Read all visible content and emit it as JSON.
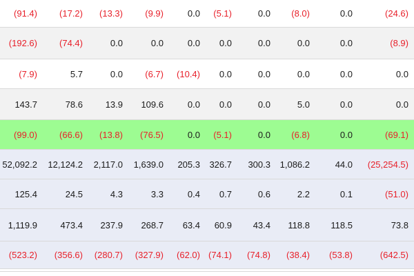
{
  "table": {
    "rows": [
      {
        "bg": "white",
        "cells": [
          {
            "text": "(91.4)",
            "neg": true
          },
          {
            "text": "(17.2)",
            "neg": true
          },
          {
            "text": "(13.3)",
            "neg": true
          },
          {
            "text": "(9.9)",
            "neg": true
          },
          {
            "text": "0.0",
            "neg": false
          },
          {
            "text": "(5.1)",
            "neg": true
          },
          {
            "text": "0.0",
            "neg": false
          },
          {
            "text": "(8.0)",
            "neg": true
          },
          {
            "text": "0.0",
            "neg": false
          },
          {
            "text": "(24.6)",
            "neg": true
          }
        ]
      },
      {
        "bg": "gray",
        "cells": [
          {
            "text": "(192.6)",
            "neg": true
          },
          {
            "text": "(74.4)",
            "neg": true
          },
          {
            "text": "0.0",
            "neg": false
          },
          {
            "text": "0.0",
            "neg": false
          },
          {
            "text": "0.0",
            "neg": false
          },
          {
            "text": "0.0",
            "neg": false
          },
          {
            "text": "0.0",
            "neg": false
          },
          {
            "text": "0.0",
            "neg": false
          },
          {
            "text": "0.0",
            "neg": false
          },
          {
            "text": "(8.9)",
            "neg": true
          }
        ]
      },
      {
        "bg": "white",
        "cells": [
          {
            "text": "(7.9)",
            "neg": true
          },
          {
            "text": "5.7",
            "neg": false
          },
          {
            "text": "0.0",
            "neg": false
          },
          {
            "text": "(6.7)",
            "neg": true
          },
          {
            "text": "(10.4)",
            "neg": true
          },
          {
            "text": "0.0",
            "neg": false
          },
          {
            "text": "0.0",
            "neg": false
          },
          {
            "text": "0.0",
            "neg": false
          },
          {
            "text": "0.0",
            "neg": false
          },
          {
            "text": "0.0",
            "neg": false
          }
        ]
      },
      {
        "bg": "gray",
        "cells": [
          {
            "text": "143.7",
            "neg": false
          },
          {
            "text": "78.6",
            "neg": false
          },
          {
            "text": "13.9",
            "neg": false
          },
          {
            "text": "109.6",
            "neg": false
          },
          {
            "text": "0.0",
            "neg": false
          },
          {
            "text": "0.0",
            "neg": false
          },
          {
            "text": "0.0",
            "neg": false
          },
          {
            "text": "5.0",
            "neg": false
          },
          {
            "text": "0.0",
            "neg": false
          },
          {
            "text": "0.0",
            "neg": false
          }
        ]
      },
      {
        "bg": "green",
        "cells": [
          {
            "text": "(99.0)",
            "neg": true
          },
          {
            "text": "(66.6)",
            "neg": true
          },
          {
            "text": "(13.8)",
            "neg": true
          },
          {
            "text": "(76.5)",
            "neg": true
          },
          {
            "text": "0.0",
            "neg": false
          },
          {
            "text": "(5.1)",
            "neg": true
          },
          {
            "text": "0.0",
            "neg": false
          },
          {
            "text": "(6.8)",
            "neg": true
          },
          {
            "text": "0.0",
            "neg": false
          },
          {
            "text": "(69.1)",
            "neg": true
          }
        ]
      },
      {
        "bg": "lavender",
        "cells": [
          {
            "text": "52,092.2",
            "neg": false
          },
          {
            "text": "12,124.2",
            "neg": false
          },
          {
            "text": "2,117.0",
            "neg": false
          },
          {
            "text": "1,639.0",
            "neg": false
          },
          {
            "text": "205.3",
            "neg": false
          },
          {
            "text": "326.7",
            "neg": false
          },
          {
            "text": "300.3",
            "neg": false
          },
          {
            "text": "1,086.2",
            "neg": false
          },
          {
            "text": "44.0",
            "neg": false
          },
          {
            "text": "(25,254.5)",
            "neg": true
          }
        ]
      },
      {
        "bg": "lavender",
        "cells": [
          {
            "text": "125.4",
            "neg": false
          },
          {
            "text": "24.5",
            "neg": false
          },
          {
            "text": "4.3",
            "neg": false
          },
          {
            "text": "3.3",
            "neg": false
          },
          {
            "text": "0.4",
            "neg": false
          },
          {
            "text": "0.7",
            "neg": false
          },
          {
            "text": "0.6",
            "neg": false
          },
          {
            "text": "2.2",
            "neg": false
          },
          {
            "text": "0.1",
            "neg": false
          },
          {
            "text": "(51.0)",
            "neg": true
          }
        ]
      },
      {
        "bg": "lavender",
        "cells": [
          {
            "text": "1,119.9",
            "neg": false
          },
          {
            "text": "473.4",
            "neg": false
          },
          {
            "text": "237.9",
            "neg": false
          },
          {
            "text": "268.7",
            "neg": false
          },
          {
            "text": "63.4",
            "neg": false
          },
          {
            "text": "60.9",
            "neg": false
          },
          {
            "text": "43.4",
            "neg": false
          },
          {
            "text": "118.8",
            "neg": false
          },
          {
            "text": "118.5",
            "neg": false
          },
          {
            "text": "73.8",
            "neg": false
          }
        ]
      },
      {
        "bg": "lavender",
        "cells": [
          {
            "text": "(523.2)",
            "neg": true
          },
          {
            "text": "(356.6)",
            "neg": true
          },
          {
            "text": "(280.7)",
            "neg": true
          },
          {
            "text": "(327.9)",
            "neg": true
          },
          {
            "text": "(62.0)",
            "neg": true
          },
          {
            "text": "(74.1)",
            "neg": true
          },
          {
            "text": "(74.8)",
            "neg": true
          },
          {
            "text": "(38.4)",
            "neg": true
          },
          {
            "text": "(53.8)",
            "neg": true
          },
          {
            "text": "(642.5)",
            "neg": true
          }
        ]
      }
    ]
  },
  "colors": {
    "negative": "#e8202a",
    "positive": "#1a1a1a",
    "row_white": "#ffffff",
    "row_gray": "#f2f2f2",
    "row_highlight": "#9dfc92",
    "row_summary": "#e9ecf6"
  }
}
